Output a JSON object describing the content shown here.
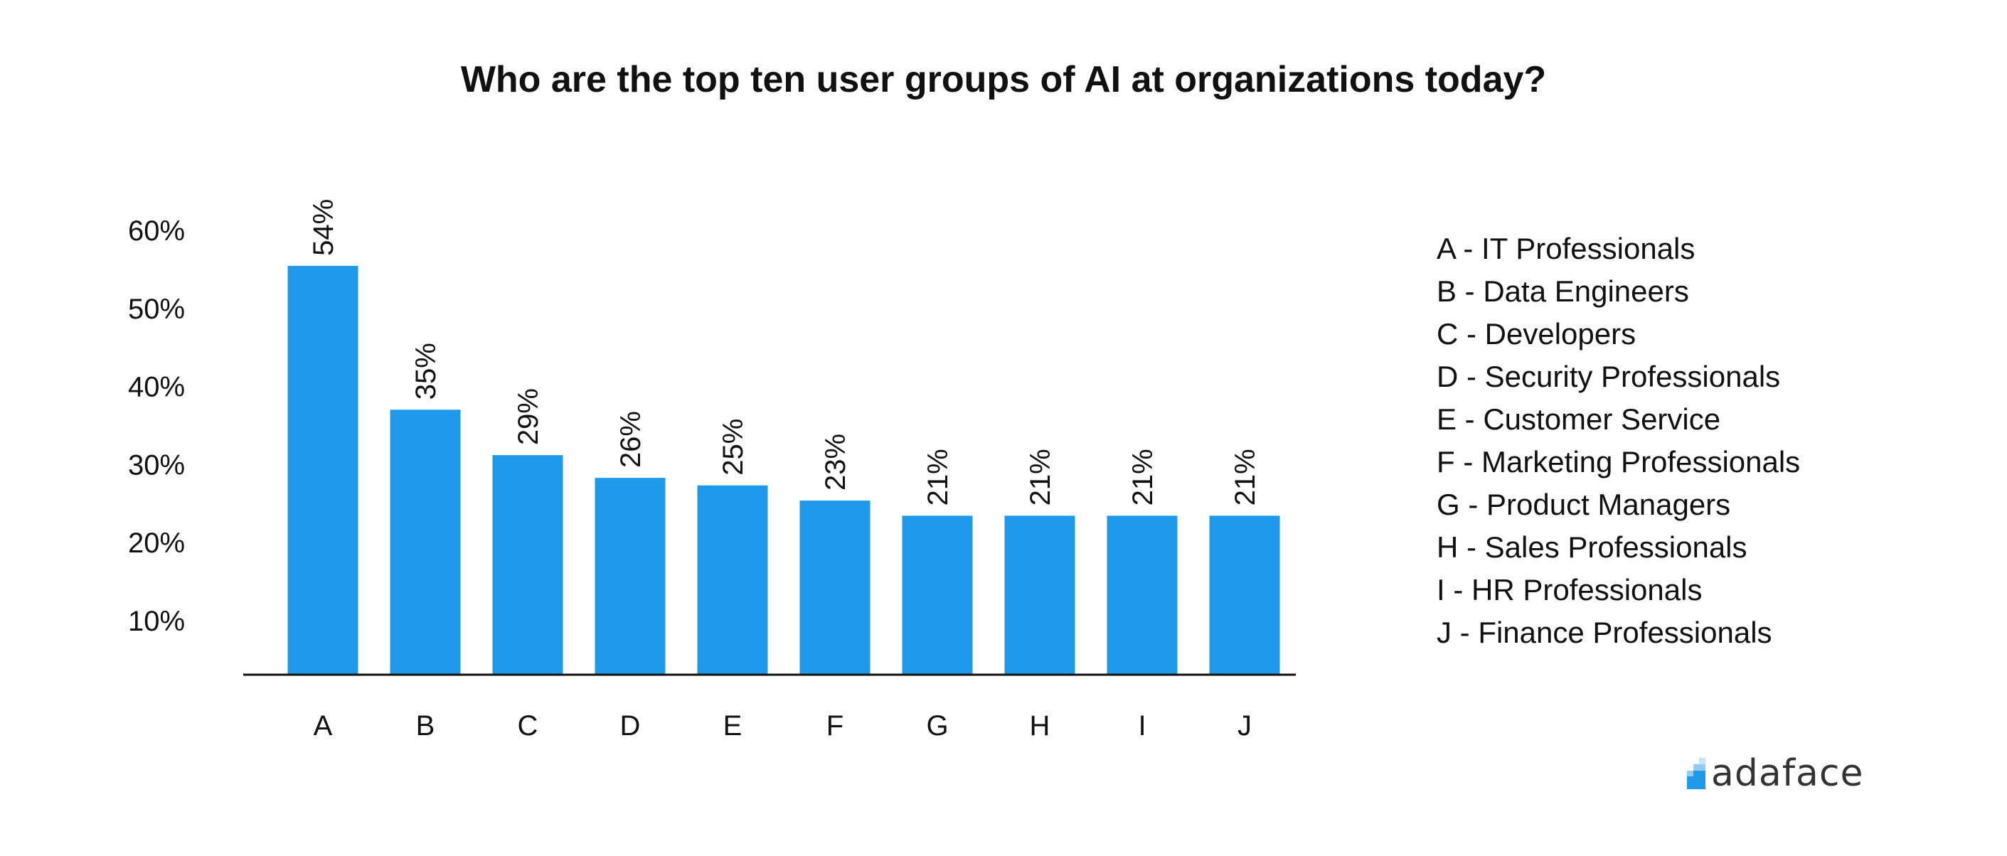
{
  "chart_data": {
    "type": "bar",
    "title": "Who are the top ten user groups of AI at organizations today?",
    "categories": [
      "A",
      "B",
      "C",
      "D",
      "E",
      "F",
      "G",
      "H",
      "I",
      "J"
    ],
    "values": [
      54,
      35,
      29,
      26,
      25,
      23,
      21,
      21,
      21,
      21
    ],
    "value_labels": [
      "54%",
      "35%",
      "29%",
      "26%",
      "25%",
      "23%",
      "21%",
      "21%",
      "21%",
      "21%"
    ],
    "y_ticks": [
      10,
      20,
      30,
      40,
      50,
      60
    ],
    "y_tick_labels": [
      "10%",
      "20%",
      "30%",
      "40%",
      "50%",
      "60%"
    ],
    "ylim": [
      0,
      60
    ],
    "xlabel": "",
    "ylabel": "",
    "grid": false,
    "bar_color": "#1f9aea",
    "legend_placement": "right",
    "legend": [
      "A - IT Professionals",
      "B - Data Engineers",
      "C - Developers",
      "D - Security Professionals",
      "E - Customer Service",
      "F - Marketing Professionals",
      "G - Product Managers",
      "H - Sales Professionals",
      "I - HR Professionals",
      "J - Finance Professionals"
    ]
  },
  "brand": {
    "name": "adaface",
    "color": "#1f9aea"
  }
}
